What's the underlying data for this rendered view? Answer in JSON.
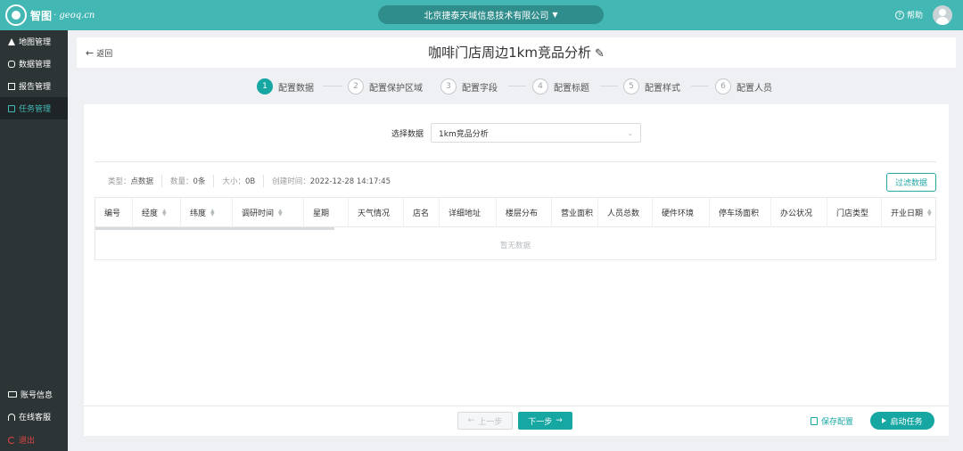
{
  "topbar": {
    "logo_text": "智图",
    "logo_sub": "· geoq.cn",
    "company": "北京捷泰天域信息技术有限公司",
    "help": "帮助"
  },
  "sidebar": {
    "items": [
      {
        "label": "地图管理",
        "icon": "map-icon"
      },
      {
        "label": "数据管理",
        "icon": "database-icon"
      },
      {
        "label": "报告管理",
        "icon": "report-icon"
      },
      {
        "label": "任务管理",
        "icon": "task-icon",
        "active": true
      }
    ],
    "bottom": [
      {
        "label": "账号信息",
        "icon": "account-card-icon"
      },
      {
        "label": "在线客服",
        "icon": "headset-icon"
      },
      {
        "label": "退出",
        "icon": "logout-icon"
      }
    ]
  },
  "header": {
    "back": "返回",
    "title": "咖啡门店周边1km竞品分析"
  },
  "steps": [
    {
      "num": "1",
      "label": "配置数据",
      "active": true
    },
    {
      "num": "2",
      "label": "配置保护区域"
    },
    {
      "num": "3",
      "label": "配置字段"
    },
    {
      "num": "4",
      "label": "配置标题"
    },
    {
      "num": "5",
      "label": "配置样式"
    },
    {
      "num": "6",
      "label": "配置人员"
    }
  ],
  "data_select": {
    "label": "选择数据",
    "value": "1km竞品分析"
  },
  "meta": {
    "type_label": "类型：",
    "type_value": "点数据",
    "count_label": "数量：",
    "count_value": "0条",
    "size_label": "大小：",
    "size_value": "0B",
    "created_label": "创建时间：",
    "created_value": "2022-12-28 14:17:45"
  },
  "filter_button": "过滤数据",
  "table": {
    "columns": [
      "编号",
      "经度",
      "纬度",
      "调研时间",
      "星期",
      "天气情况",
      "店名",
      "详细地址",
      "楼层分布",
      "营业面积",
      "人员总数",
      "硬件环境",
      "停车场面积",
      "办公状况",
      "门店类型",
      "开业日期"
    ],
    "sortable": [
      false,
      true,
      true,
      true,
      false,
      false,
      false,
      false,
      false,
      false,
      false,
      false,
      false,
      false,
      false,
      true
    ],
    "empty_text": "暂无数据"
  },
  "footer": {
    "prev": "上一步",
    "next": "下一步",
    "save": "保存配置",
    "start": "启动任务"
  },
  "colors": {
    "topbar": "#43b7b4",
    "accent": "#17a7a3",
    "sidebar": "#2d3436"
  }
}
